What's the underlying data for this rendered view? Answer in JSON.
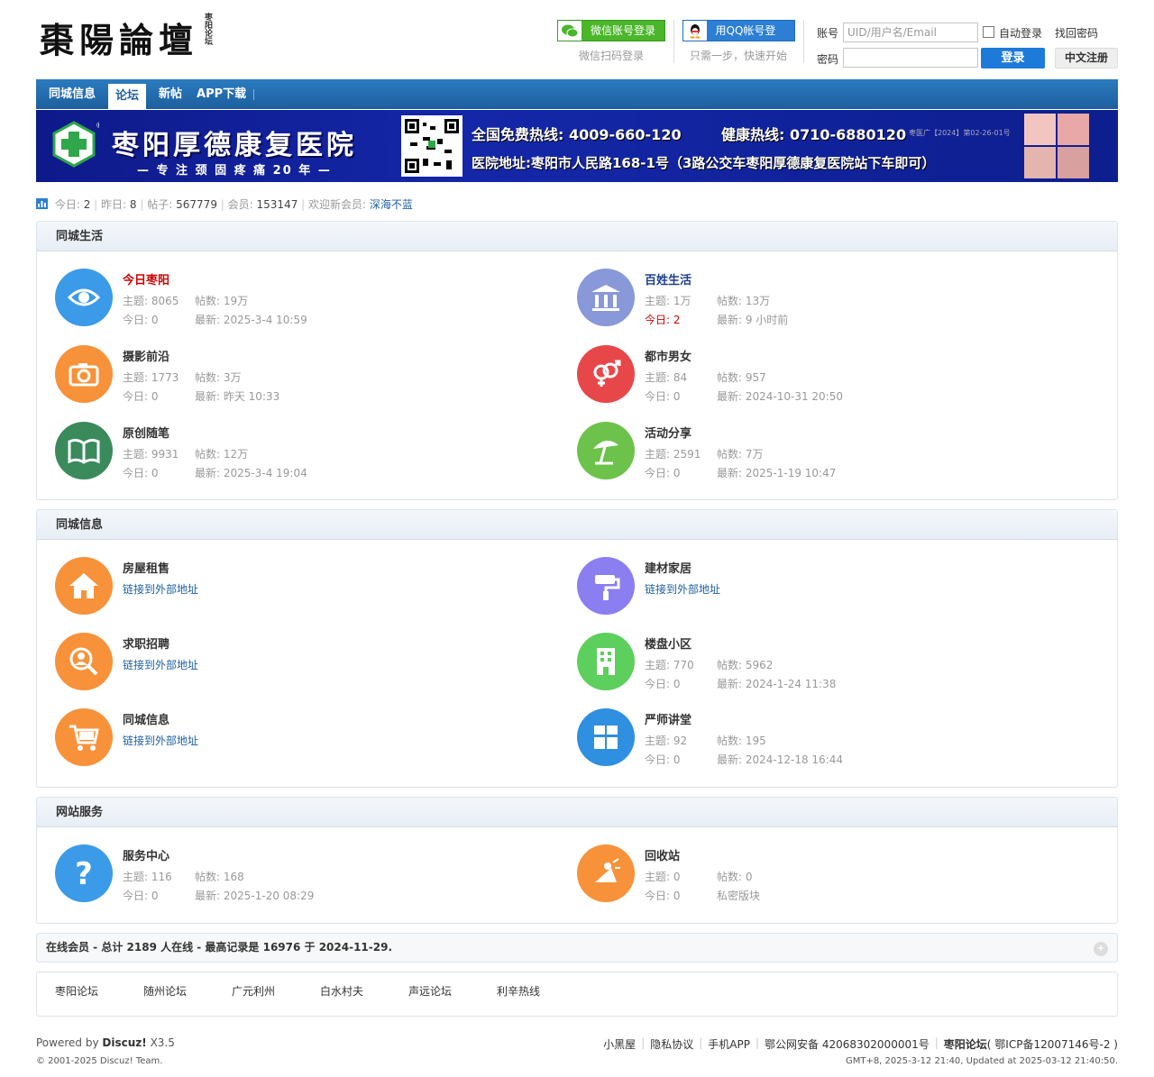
{
  "header": {
    "logo_text": "棗陽論壇",
    "logo_sign": "枣阳论坛",
    "wechat_login": "微信账号登录",
    "wechat_hint": "微信扫码登录",
    "qq_login": "用QQ帐号登录",
    "qq_hint": "只需一步，快速开始",
    "account_label": "账号",
    "account_placeholder": "UID/用户名/Email",
    "auto_login": "自动登录",
    "find_password": "找回密码",
    "password_label": "密码",
    "login_button": "登录",
    "register_button": "中文注册"
  },
  "nav": {
    "items": [
      "同城信息",
      "论坛",
      "新帖",
      "APP下载"
    ],
    "active": 1
  },
  "banner": {
    "title": "枣阳厚德康复医院",
    "slogan": "— 专 注 颈 固 疼 痛 20 年 —",
    "hotline": "全国免费热线: 4009-660-120",
    "health_line": "健康热线: 0710-6880120",
    "license": "枣医广【2024】第02-26-01号",
    "address": "医院地址:枣阳市人民路168-1号（3路公交车枣阳厚德康复医院站下车即可）"
  },
  "stats": {
    "today_label": "今日:",
    "today": "2",
    "yesterday_label": "昨日:",
    "yesterday": "8",
    "posts_label": "帖子:",
    "posts": "567779",
    "members_label": "会员:",
    "members": "153147",
    "welcome_label": "欢迎新会员:",
    "newest": "深海不蓝"
  },
  "sections": [
    {
      "title": "同城生活",
      "forums": [
        {
          "name": "今日枣阳",
          "icon": "eye-icon",
          "color": "#3b9be8",
          "name_color": "#d00000",
          "r1a": "主题: 8065",
          "r1b": "帖数: 19万",
          "r2a": "今日: 0",
          "r2b": "最新: 2025-3-4 10:59"
        },
        {
          "name": "百姓生活",
          "icon": "bank-icon",
          "color": "#8898d8",
          "name_color": "#1d3f8e",
          "r1a": "主题: 1万",
          "r1b": "帖数: 13万",
          "r2a": "今日: 2",
          "r2b": "最新: 9 小时前",
          "today_red": true
        },
        {
          "name": "摄影前沿",
          "icon": "camera-icon",
          "color": "#f7923a",
          "r1a": "主题: 1773",
          "r1b": "帖数: 3万",
          "r2a": "今日: 0",
          "r2b": "最新: 昨天 10:33"
        },
        {
          "name": "都市男女",
          "icon": "gender-icon",
          "color": "#e8474a",
          "r1a": "主题: 84",
          "r1b": "帖数: 957",
          "r2a": "今日: 0",
          "r2b": "最新: 2024-10-31 20:50"
        },
        {
          "name": "原创随笔",
          "icon": "book-icon",
          "color": "#3a8a5c",
          "r1a": "主题: 9931",
          "r1b": "帖数: 12万",
          "r2a": "今日: 0",
          "r2b": "最新: 2025-3-4 19:04"
        },
        {
          "name": "活动分享",
          "icon": "umbrella-icon",
          "color": "#6cc24a",
          "r1a": "主题: 2591",
          "r1b": "帖数: 7万",
          "r2a": "今日: 0",
          "r2b": "最新: 2025-1-19 10:47"
        }
      ]
    },
    {
      "title": "同城信息",
      "forums": [
        {
          "name": "房屋租售",
          "icon": "house-icon",
          "color": "#f7923a",
          "ext": "链接到外部地址"
        },
        {
          "name": "建材家居",
          "icon": "paint-roller-icon",
          "color": "#8a7ef0",
          "ext": "链接到外部地址"
        },
        {
          "name": "求职招聘",
          "icon": "search-person-icon",
          "color": "#f7923a",
          "ext": "链接到外部地址"
        },
        {
          "name": "楼盘小区",
          "icon": "building-icon",
          "color": "#5ccf5c",
          "r1a": "主题: 770",
          "r1b": "帖数: 5962",
          "r2a": "今日: 0",
          "r2b": "最新: 2024-1-24 11:38"
        },
        {
          "name": "同城信息",
          "icon": "cart-icon",
          "color": "#f7923a",
          "ext": "链接到外部地址"
        },
        {
          "name": "严师讲堂",
          "icon": "grid-icon",
          "color": "#2f8fe0",
          "r1a": "主题: 92",
          "r1b": "帖数: 195",
          "r2a": "今日: 0",
          "r2b": "最新: 2024-12-18 16:44"
        }
      ]
    },
    {
      "title": "网站服务",
      "forums": [
        {
          "name": "服务中心",
          "icon": "question-icon",
          "color": "#3b9be8",
          "r1a": "主题: 116",
          "r1b": "帖数: 168",
          "r2a": "今日: 0",
          "r2b": "最新: 2025-1-20 08:29"
        },
        {
          "name": "回收站",
          "icon": "recycle-icon",
          "color": "#f7923a",
          "r1a": "主题: 0",
          "r1b": "帖数: 0",
          "r2a": "今日: 0",
          "r2b": "私密版块"
        }
      ]
    }
  ],
  "online": {
    "text": "在线会员 - 总计 2189 人在线 - 最高记录是 16976 于 2024-11-29.",
    "toggle": "+"
  },
  "friend_links": [
    "枣阳论坛",
    "随州论坛",
    "广元利州",
    "白水村夫",
    "声远论坛",
    "利辛热线"
  ],
  "footer": {
    "powered": "Powered by",
    "discuz": "Discuz!",
    "version": "X3.5",
    "copyright": "© 2001-2025 Discuz! Team.",
    "links": [
      "小黑屋",
      "隐私协议",
      "手机APP",
      "鄂公网安备 42068302000001号",
      "枣阳论坛",
      "( 鄂ICP备12007146号-2 )"
    ],
    "time": "GMT+8, 2025-3-12 21:40, Updated at 2025-03-12 21:40:50."
  }
}
